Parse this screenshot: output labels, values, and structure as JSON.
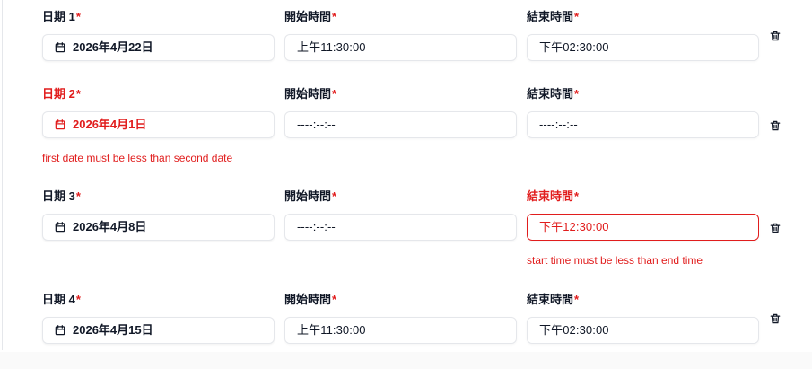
{
  "rows": [
    {
      "date_label": "日期 1",
      "date_value": "2026年4月22日",
      "start_label": "開始時間",
      "start_value": "上午11:30:00",
      "end_label": "結束時間",
      "end_value": "下午02:30:00",
      "required_mark": "*"
    },
    {
      "date_label": "日期 2",
      "date_value": "2026年4月1日",
      "start_label": "開始時間",
      "start_value": "----:--:--",
      "end_label": "結束時間",
      "end_value": "----:--:--",
      "required_mark": "*",
      "error_text": "first date must be less than second date"
    },
    {
      "date_label": "日期 3",
      "date_value": "2026年4月8日",
      "start_label": "開始時間",
      "start_value": "----:--:--",
      "end_label": "結束時間",
      "end_value": "下午12:30:00",
      "required_mark": "*",
      "error_text": "start time must be less than end time"
    },
    {
      "date_label": "日期 4",
      "date_value": "2026年4月15日",
      "start_label": "開始時間",
      "start_value": "上午11:30:00",
      "end_label": "結束時間",
      "end_value": "下午02:30:00",
      "required_mark": "*"
    }
  ],
  "colors": {
    "error": "#e11d1d",
    "border": "#e5e7eb",
    "text": "#111827"
  },
  "icons": {
    "date": "calendar-icon",
    "delete": "trash-icon"
  }
}
